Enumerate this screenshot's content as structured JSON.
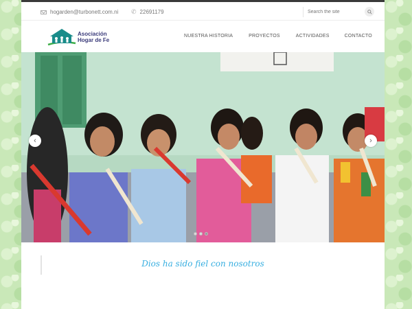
{
  "topbar": {
    "email": "hogarden@turbonett.com.ni",
    "phone": "22691179",
    "search_placeholder": "Search the site"
  },
  "logo": {
    "line1": "Asociación",
    "line2": "Hogar de Fe"
  },
  "nav": [
    {
      "label": "NUESTRA HISTORIA"
    },
    {
      "label": "PROYECTOS"
    },
    {
      "label": "ACTIVIDADES"
    },
    {
      "label": "CONTACTO"
    }
  ],
  "slider": {
    "image_alt": "Girls playing recorders in a classroom",
    "prev_icon": "chevron-left-icon",
    "next_icon": "chevron-right-icon",
    "slide_count": 3,
    "active_slide": 3
  },
  "tagline": "Dios ha sido fiel con nosotros",
  "colors": {
    "accent": "#36aee0",
    "logo_green": "#3fae49",
    "logo_teal": "#1a8c8a",
    "logo_text": "#3b3b7a",
    "background_pattern": "#c9e8b8"
  }
}
